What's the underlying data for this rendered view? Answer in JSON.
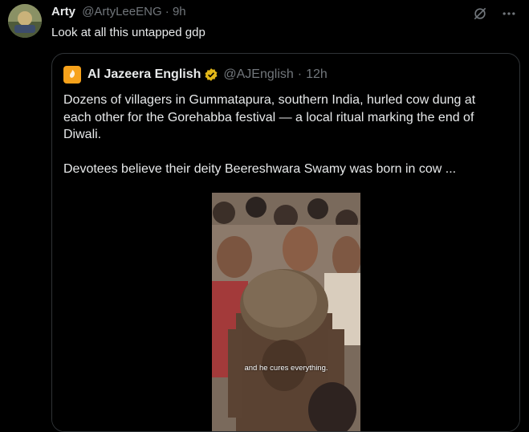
{
  "tweet": {
    "author_name": "Arty",
    "author_handle": "@ArtyLeeENG",
    "separator": "·",
    "time": "9h",
    "text": "Look at all this untapped gdp",
    "avatar_icon": "avatar-image",
    "actions": [
      "grok-icon",
      "more-icon"
    ]
  },
  "quote": {
    "author_name": "Al Jazeera English",
    "author_handle": "@AJEnglish",
    "separator": "·",
    "time": "12h",
    "logo_icon": "al-jazeera-logo",
    "verified_icon": "gold-verified-badge",
    "paragraph1": "Dozens of villagers in Gummatapura, southern India, hurled cow dung at each other for the Gorehabba festival — a local ritual marking the end of Diwali.",
    "paragraph2": "Devotees believe their deity Beereshwara Swamy was born in cow ...",
    "video_caption": "and he cures everything."
  },
  "colors": {
    "background": "#000000",
    "text": "#e7e9ea",
    "muted": "#71767b",
    "border": "#2f3336",
    "logo_accent": "#f7a21b",
    "verified": "#e2b719"
  }
}
